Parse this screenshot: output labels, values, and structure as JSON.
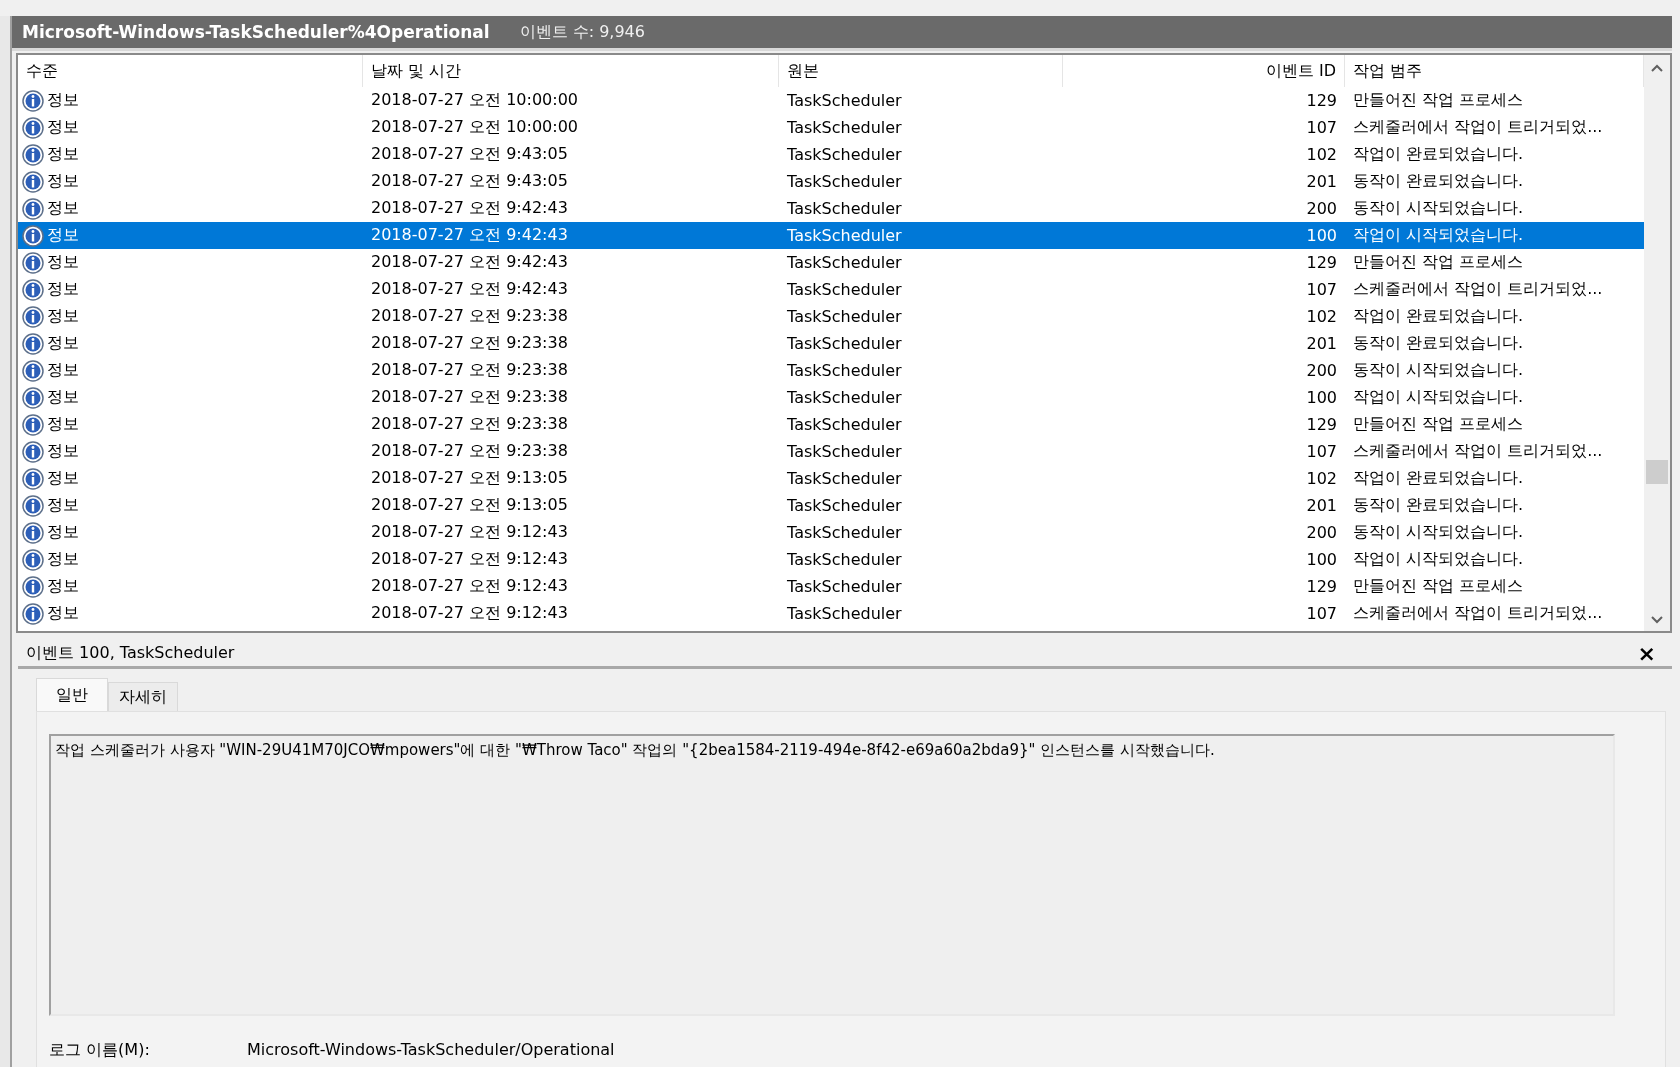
{
  "log_header": {
    "title": "Microsoft-Windows-TaskScheduler%4Operational",
    "count": "이벤트 수: 9,946"
  },
  "table": {
    "columns": [
      "수준",
      "날짜 및 시간",
      "원본",
      "이벤트 ID",
      "작업 범주"
    ],
    "rows": [
      {
        "level": "정보",
        "date": "2018-07-27 오전 10:00:00",
        "source": "TaskScheduler",
        "event_id": "129",
        "category": "만들어진 작업 프로세스",
        "selected": false
      },
      {
        "level": "정보",
        "date": "2018-07-27 오전 10:00:00",
        "source": "TaskScheduler",
        "event_id": "107",
        "category": "스케줄러에서 작업이 트리거되었...",
        "selected": false
      },
      {
        "level": "정보",
        "date": "2018-07-27 오전 9:43:05",
        "source": "TaskScheduler",
        "event_id": "102",
        "category": "작업이 완료되었습니다.",
        "selected": false
      },
      {
        "level": "정보",
        "date": "2018-07-27 오전 9:43:05",
        "source": "TaskScheduler",
        "event_id": "201",
        "category": "동작이 완료되었습니다.",
        "selected": false
      },
      {
        "level": "정보",
        "date": "2018-07-27 오전 9:42:43",
        "source": "TaskScheduler",
        "event_id": "200",
        "category": "동작이 시작되었습니다.",
        "selected": false
      },
      {
        "level": "정보",
        "date": "2018-07-27 오전 9:42:43",
        "source": "TaskScheduler",
        "event_id": "100",
        "category": "작업이 시작되었습니다.",
        "selected": true
      },
      {
        "level": "정보",
        "date": "2018-07-27 오전 9:42:43",
        "source": "TaskScheduler",
        "event_id": "129",
        "category": "만들어진 작업 프로세스",
        "selected": false
      },
      {
        "level": "정보",
        "date": "2018-07-27 오전 9:42:43",
        "source": "TaskScheduler",
        "event_id": "107",
        "category": "스케줄러에서 작업이 트리거되었...",
        "selected": false
      },
      {
        "level": "정보",
        "date": "2018-07-27 오전 9:23:38",
        "source": "TaskScheduler",
        "event_id": "102",
        "category": "작업이 완료되었습니다.",
        "selected": false
      },
      {
        "level": "정보",
        "date": "2018-07-27 오전 9:23:38",
        "source": "TaskScheduler",
        "event_id": "201",
        "category": "동작이 완료되었습니다.",
        "selected": false
      },
      {
        "level": "정보",
        "date": "2018-07-27 오전 9:23:38",
        "source": "TaskScheduler",
        "event_id": "200",
        "category": "동작이 시작되었습니다.",
        "selected": false
      },
      {
        "level": "정보",
        "date": "2018-07-27 오전 9:23:38",
        "source": "TaskScheduler",
        "event_id": "100",
        "category": "작업이 시작되었습니다.",
        "selected": false
      },
      {
        "level": "정보",
        "date": "2018-07-27 오전 9:23:38",
        "source": "TaskScheduler",
        "event_id": "129",
        "category": "만들어진 작업 프로세스",
        "selected": false
      },
      {
        "level": "정보",
        "date": "2018-07-27 오전 9:23:38",
        "source": "TaskScheduler",
        "event_id": "107",
        "category": "스케줄러에서 작업이 트리거되었...",
        "selected": false
      },
      {
        "level": "정보",
        "date": "2018-07-27 오전 9:13:05",
        "source": "TaskScheduler",
        "event_id": "102",
        "category": "작업이 완료되었습니다.",
        "selected": false
      },
      {
        "level": "정보",
        "date": "2018-07-27 오전 9:13:05",
        "source": "TaskScheduler",
        "event_id": "201",
        "category": "동작이 완료되었습니다.",
        "selected": false
      },
      {
        "level": "정보",
        "date": "2018-07-27 오전 9:12:43",
        "source": "TaskScheduler",
        "event_id": "200",
        "category": "동작이 시작되었습니다.",
        "selected": false
      },
      {
        "level": "정보",
        "date": "2018-07-27 오전 9:12:43",
        "source": "TaskScheduler",
        "event_id": "100",
        "category": "작업이 시작되었습니다.",
        "selected": false
      },
      {
        "level": "정보",
        "date": "2018-07-27 오전 9:12:43",
        "source": "TaskScheduler",
        "event_id": "129",
        "category": "만들어진 작업 프로세스",
        "selected": false
      },
      {
        "level": "정보",
        "date": "2018-07-27 오전 9:12:43",
        "source": "TaskScheduler",
        "event_id": "107",
        "category": "스케줄러에서 작업이 트리거되었...",
        "selected": false
      }
    ]
  },
  "detail": {
    "title": "이벤트 100, TaskScheduler",
    "close": "×",
    "tabs": [
      {
        "label": "일반",
        "selected": true
      },
      {
        "label": "자세히",
        "selected": false
      }
    ],
    "description": "작업 스케줄러가 사용자 \"WIN-29U41M70JCO₩mpowers\"에 대한 \"₩Throw Taco\" 작업의 \"{2bea1584-2119-494e-8f42-e69a60a2bda9}\" 인스턴스를 시작했습니다.",
    "log_name_label": "로그 이름(M):",
    "log_name_value": "Microsoft-Windows-TaskScheduler/Operational"
  }
}
